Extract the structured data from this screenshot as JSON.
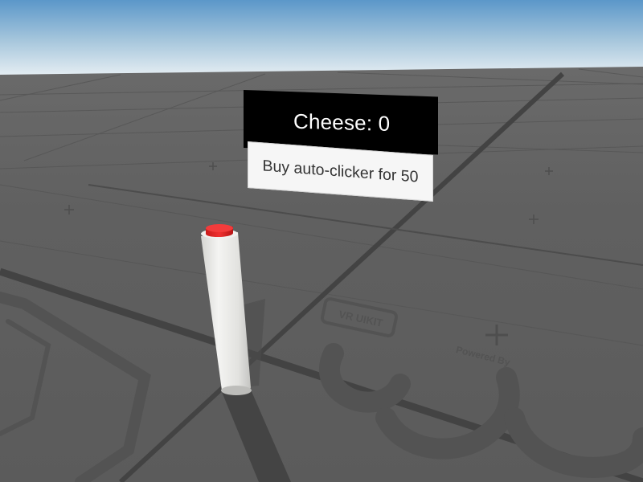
{
  "hud": {
    "cheese_label": "Cheese: 0"
  },
  "shop": {
    "buy_autoclicker_label": "Buy auto-clicker for 50"
  },
  "floor_decal": {
    "brand_text": "VR UIKIT",
    "powered_by": "Powered By"
  },
  "colors": {
    "sky_top": "#5b97c9",
    "sky_horizon": "#e6eef3",
    "floor": "#5e5e5e",
    "grid_line": "#4f4f4f",
    "panel_bg": "#000000",
    "panel_text": "#ffffff",
    "button_bg": "#f6f6f6",
    "button_text": "#333333",
    "pillar": "#e9e9e6",
    "pillar_button": "#e02424"
  }
}
